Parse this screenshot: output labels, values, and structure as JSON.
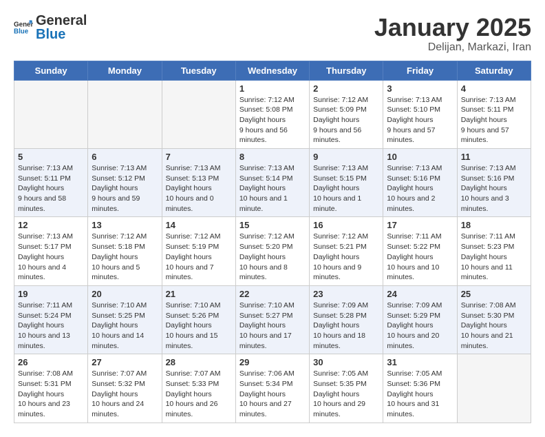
{
  "header": {
    "logo_general": "General",
    "logo_blue": "Blue",
    "month": "January 2025",
    "location": "Delijan, Markazi, Iran"
  },
  "weekdays": [
    "Sunday",
    "Monday",
    "Tuesday",
    "Wednesday",
    "Thursday",
    "Friday",
    "Saturday"
  ],
  "weeks": [
    [
      {
        "day": "",
        "empty": true
      },
      {
        "day": "",
        "empty": true
      },
      {
        "day": "",
        "empty": true
      },
      {
        "day": "1",
        "sunrise": "7:12 AM",
        "sunset": "5:08 PM",
        "daylight": "9 hours and 56 minutes."
      },
      {
        "day": "2",
        "sunrise": "7:12 AM",
        "sunset": "5:09 PM",
        "daylight": "9 hours and 56 minutes."
      },
      {
        "day": "3",
        "sunrise": "7:13 AM",
        "sunset": "5:10 PM",
        "daylight": "9 hours and 57 minutes."
      },
      {
        "day": "4",
        "sunrise": "7:13 AM",
        "sunset": "5:11 PM",
        "daylight": "9 hours and 57 minutes."
      }
    ],
    [
      {
        "day": "5",
        "sunrise": "7:13 AM",
        "sunset": "5:11 PM",
        "daylight": "9 hours and 58 minutes."
      },
      {
        "day": "6",
        "sunrise": "7:13 AM",
        "sunset": "5:12 PM",
        "daylight": "9 hours and 59 minutes."
      },
      {
        "day": "7",
        "sunrise": "7:13 AM",
        "sunset": "5:13 PM",
        "daylight": "10 hours and 0 minutes."
      },
      {
        "day": "8",
        "sunrise": "7:13 AM",
        "sunset": "5:14 PM",
        "daylight": "10 hours and 1 minute."
      },
      {
        "day": "9",
        "sunrise": "7:13 AM",
        "sunset": "5:15 PM",
        "daylight": "10 hours and 1 minute."
      },
      {
        "day": "10",
        "sunrise": "7:13 AM",
        "sunset": "5:16 PM",
        "daylight": "10 hours and 2 minutes."
      },
      {
        "day": "11",
        "sunrise": "7:13 AM",
        "sunset": "5:16 PM",
        "daylight": "10 hours and 3 minutes."
      }
    ],
    [
      {
        "day": "12",
        "sunrise": "7:13 AM",
        "sunset": "5:17 PM",
        "daylight": "10 hours and 4 minutes."
      },
      {
        "day": "13",
        "sunrise": "7:12 AM",
        "sunset": "5:18 PM",
        "daylight": "10 hours and 5 minutes."
      },
      {
        "day": "14",
        "sunrise": "7:12 AM",
        "sunset": "5:19 PM",
        "daylight": "10 hours and 7 minutes."
      },
      {
        "day": "15",
        "sunrise": "7:12 AM",
        "sunset": "5:20 PM",
        "daylight": "10 hours and 8 minutes."
      },
      {
        "day": "16",
        "sunrise": "7:12 AM",
        "sunset": "5:21 PM",
        "daylight": "10 hours and 9 minutes."
      },
      {
        "day": "17",
        "sunrise": "7:11 AM",
        "sunset": "5:22 PM",
        "daylight": "10 hours and 10 minutes."
      },
      {
        "day": "18",
        "sunrise": "7:11 AM",
        "sunset": "5:23 PM",
        "daylight": "10 hours and 11 minutes."
      }
    ],
    [
      {
        "day": "19",
        "sunrise": "7:11 AM",
        "sunset": "5:24 PM",
        "daylight": "10 hours and 13 minutes."
      },
      {
        "day": "20",
        "sunrise": "7:10 AM",
        "sunset": "5:25 PM",
        "daylight": "10 hours and 14 minutes."
      },
      {
        "day": "21",
        "sunrise": "7:10 AM",
        "sunset": "5:26 PM",
        "daylight": "10 hours and 15 minutes."
      },
      {
        "day": "22",
        "sunrise": "7:10 AM",
        "sunset": "5:27 PM",
        "daylight": "10 hours and 17 minutes."
      },
      {
        "day": "23",
        "sunrise": "7:09 AM",
        "sunset": "5:28 PM",
        "daylight": "10 hours and 18 minutes."
      },
      {
        "day": "24",
        "sunrise": "7:09 AM",
        "sunset": "5:29 PM",
        "daylight": "10 hours and 20 minutes."
      },
      {
        "day": "25",
        "sunrise": "7:08 AM",
        "sunset": "5:30 PM",
        "daylight": "10 hours and 21 minutes."
      }
    ],
    [
      {
        "day": "26",
        "sunrise": "7:08 AM",
        "sunset": "5:31 PM",
        "daylight": "10 hours and 23 minutes."
      },
      {
        "day": "27",
        "sunrise": "7:07 AM",
        "sunset": "5:32 PM",
        "daylight": "10 hours and 24 minutes."
      },
      {
        "day": "28",
        "sunrise": "7:07 AM",
        "sunset": "5:33 PM",
        "daylight": "10 hours and 26 minutes."
      },
      {
        "day": "29",
        "sunrise": "7:06 AM",
        "sunset": "5:34 PM",
        "daylight": "10 hours and 27 minutes."
      },
      {
        "day": "30",
        "sunrise": "7:05 AM",
        "sunset": "5:35 PM",
        "daylight": "10 hours and 29 minutes."
      },
      {
        "day": "31",
        "sunrise": "7:05 AM",
        "sunset": "5:36 PM",
        "daylight": "10 hours and 31 minutes."
      },
      {
        "day": "",
        "empty": true
      }
    ]
  ],
  "labels": {
    "sunrise": "Sunrise:",
    "sunset": "Sunset:",
    "daylight": "Daylight hours"
  }
}
